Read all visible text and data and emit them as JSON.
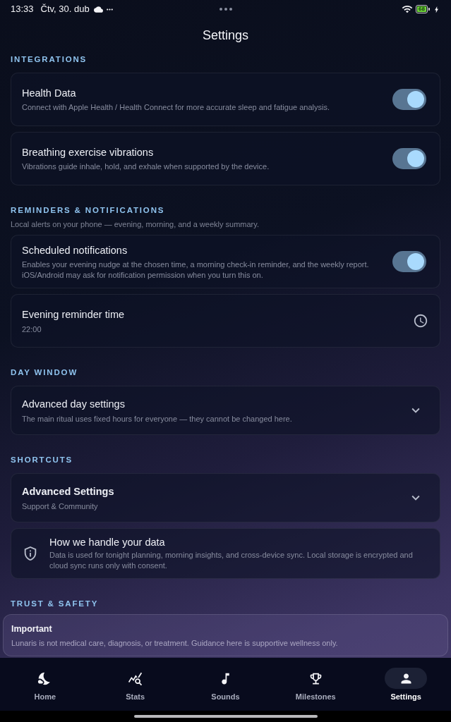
{
  "status_bar": {
    "time": "13:33",
    "date": "Čtv, 30. dub",
    "battery": "68"
  },
  "header": {
    "title": "Settings"
  },
  "sections": [
    {
      "heading": "INTEGRATIONS",
      "items": [
        {
          "kind": "toggle",
          "title": "Health Data",
          "description": "Connect with Apple Health / Health Connect for more accurate sleep and fatigue analysis.",
          "on": true
        },
        {
          "kind": "toggle",
          "title": "Breathing exercise vibrations",
          "description": "Vibrations guide inhale, hold, and exhale when supported by the device.",
          "on": true
        }
      ]
    },
    {
      "heading": "REMINDERS & NOTIFICATIONS",
      "subtitle": "Local alerts on your phone — evening, morning, and a weekly summary.",
      "items": [
        {
          "kind": "toggle",
          "title": "Scheduled notifications",
          "description": "Enables your evening nudge at the chosen time, a morning check-in reminder, and the weekly report. iOS/Android may ask for notification permission when you turn this on.",
          "on": true
        },
        {
          "kind": "time",
          "title": "Evening reminder time",
          "value": "22:00"
        }
      ]
    },
    {
      "heading": "DAY WINDOW",
      "items": [
        {
          "kind": "expander",
          "title": "Advanced day settings",
          "description": "The main ritual uses fixed hours for everyone — they cannot be changed here.",
          "expanded": false
        }
      ]
    },
    {
      "heading": "SHORTCUTS",
      "items": [
        {
          "kind": "shortcut",
          "title": "Advanced Settings",
          "description": "Support & Community",
          "expanded": false
        },
        {
          "kind": "info",
          "title": "How we handle your data",
          "description": "Data is used for tonight planning, morning insights, and cross-device sync. Local storage is encrypted and cloud sync runs only with consent."
        }
      ]
    },
    {
      "heading": "TRUST & SAFETY",
      "items": [
        {
          "kind": "notice",
          "title": "Important",
          "description": "Lunaris is not medical care, diagnosis, or treatment. Guidance here is supportive wellness only."
        }
      ]
    }
  ],
  "bottom_nav": [
    {
      "label": "Home",
      "selected": false
    },
    {
      "label": "Stats",
      "selected": false
    },
    {
      "label": "Sounds",
      "selected": false
    },
    {
      "label": "Milestones",
      "selected": false
    },
    {
      "label": "Settings",
      "selected": true
    }
  ]
}
